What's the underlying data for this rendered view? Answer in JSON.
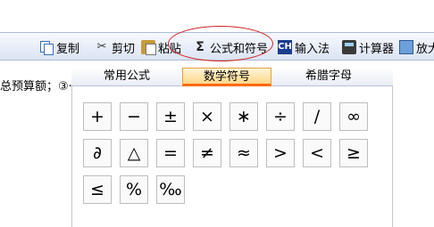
{
  "toolbar": {
    "items": [
      {
        "label": "复制",
        "icon": "copy-icon"
      },
      {
        "label": "剪切",
        "icon": "scissors-icon"
      },
      {
        "label": "粘贴",
        "icon": "paste-icon"
      },
      {
        "label": "公式和符号",
        "icon": "sigma-icon",
        "icon_glyph": "Σ"
      },
      {
        "label": "输入法",
        "icon": "ime-icon",
        "icon_glyph": "CH"
      },
      {
        "label": "计算器",
        "icon": "calculator-icon"
      },
      {
        "label": "放大",
        "icon": "zoom-icon"
      }
    ]
  },
  "background_text": "总预算额；③·····",
  "tabs": [
    {
      "label": "常用公式"
    },
    {
      "label": "数学符号"
    },
    {
      "label": "希腊字母"
    }
  ],
  "symbols": [
    "+",
    "−",
    "±",
    "×",
    "∗",
    "÷",
    "/",
    "∞",
    "∂",
    "△",
    "=",
    "≠",
    "≈",
    ">",
    "<",
    "≥",
    "≤",
    "%",
    "‰"
  ],
  "colors": {
    "highlight_oval": "#d42222",
    "active_tab_underline": "#ff6a00"
  }
}
